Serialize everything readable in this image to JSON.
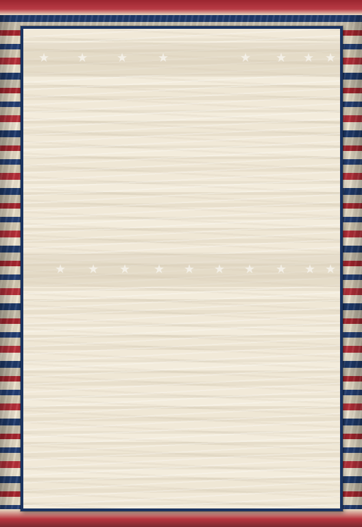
{
  "decoration": {
    "star_glyph": "★",
    "colors": {
      "flag_red": "#b8303a",
      "flag_blue": "#1f3a6b",
      "flag_cream": "#efe6d2",
      "frame_navy": "#1b3461",
      "paper": "#f1e9d8"
    }
  }
}
